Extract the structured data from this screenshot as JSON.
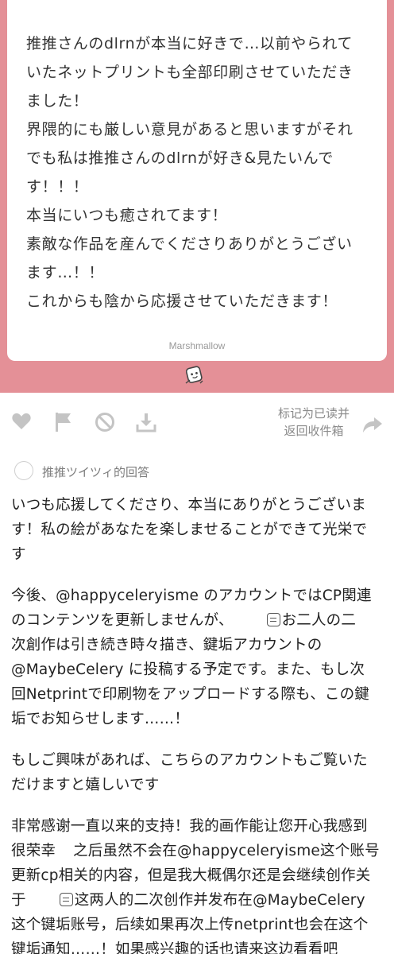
{
  "message": {
    "lines": [
      "推推さんのdlrnが本当に好きで…以前やられて",
      "いたネットプリントも全部印刷させていただき",
      "ました！",
      "界隈的にも厳しい意見があると思いますがそれ",
      "でも私は推推さんのdlrnが好き&見たいんで",
      "す！！！",
      "本当にいつも癒されてます！",
      "素敵な作品を産んでくださりありがとうござい",
      "ます…！！",
      "これからも陰から応援させていただきます！"
    ],
    "brand": "Marshmallow"
  },
  "actions": {
    "like_icon": "heart-icon",
    "flag_icon": "flag-icon",
    "block_icon": "block-icon",
    "download_icon": "download-icon",
    "mark_read_line1": "标记为已读并",
    "mark_read_line2": "返回收件箱",
    "reply_icon": "share-arrow-icon"
  },
  "answer": {
    "label": "推推ツイツィ的回答",
    "lines": [
      {
        "pre": "いつも応援してくださり、本当にありがとうございま"
      },
      {
        "pre": "す！私の絵があなたを楽しませることができて光栄で"
      },
      {
        "pre": "す"
      },
      {
        "pre": ""
      },
      {
        "pre": "今後、@happyceleryisme のアカウントではCP関連"
      },
      {
        "pre": "のコンテンツを更新しませんが、",
        "emoji": true,
        "post": "お二人の二"
      },
      {
        "pre": "次創作は引き続き時々描き、鍵垢アカウントの"
      },
      {
        "pre": "@MaybeCelery に投稿する予定です。また、もし次"
      },
      {
        "pre": "回Netprintで印刷物をアップロードする際も、この鍵"
      },
      {
        "pre": "垢でお知らせします……！"
      },
      {
        "pre": ""
      },
      {
        "pre": "もしご興味があれば、こちらのアカウントもご覧いた"
      },
      {
        "pre": "だけますと嬉しいです"
      },
      {
        "pre": ""
      },
      {
        "pre": "非常感谢一直以来的支持！我的画作能让您开心我感到"
      },
      {
        "pre": "很荣幸",
        "gap_small": true,
        "post": "之后虽然不会在@happyceleryisme这个账号"
      },
      {
        "pre": "更新cp相关的内容，但是我大概偶尔还是会继续创作关"
      },
      {
        "pre": "于",
        "emoji": true,
        "post": "这两人的二次创作并发布在@MaybeCelery"
      },
      {
        "pre": "这个键垢账号，后续如果再次上传netprint也会在这个"
      },
      {
        "pre": "键垢通知……！如果感兴趣的话也请来这边看看吧"
      }
    ]
  },
  "colors": {
    "card_background": "#e49097",
    "icon_gray": "#c4c4c4",
    "text_gray": "#8a8a8a"
  }
}
